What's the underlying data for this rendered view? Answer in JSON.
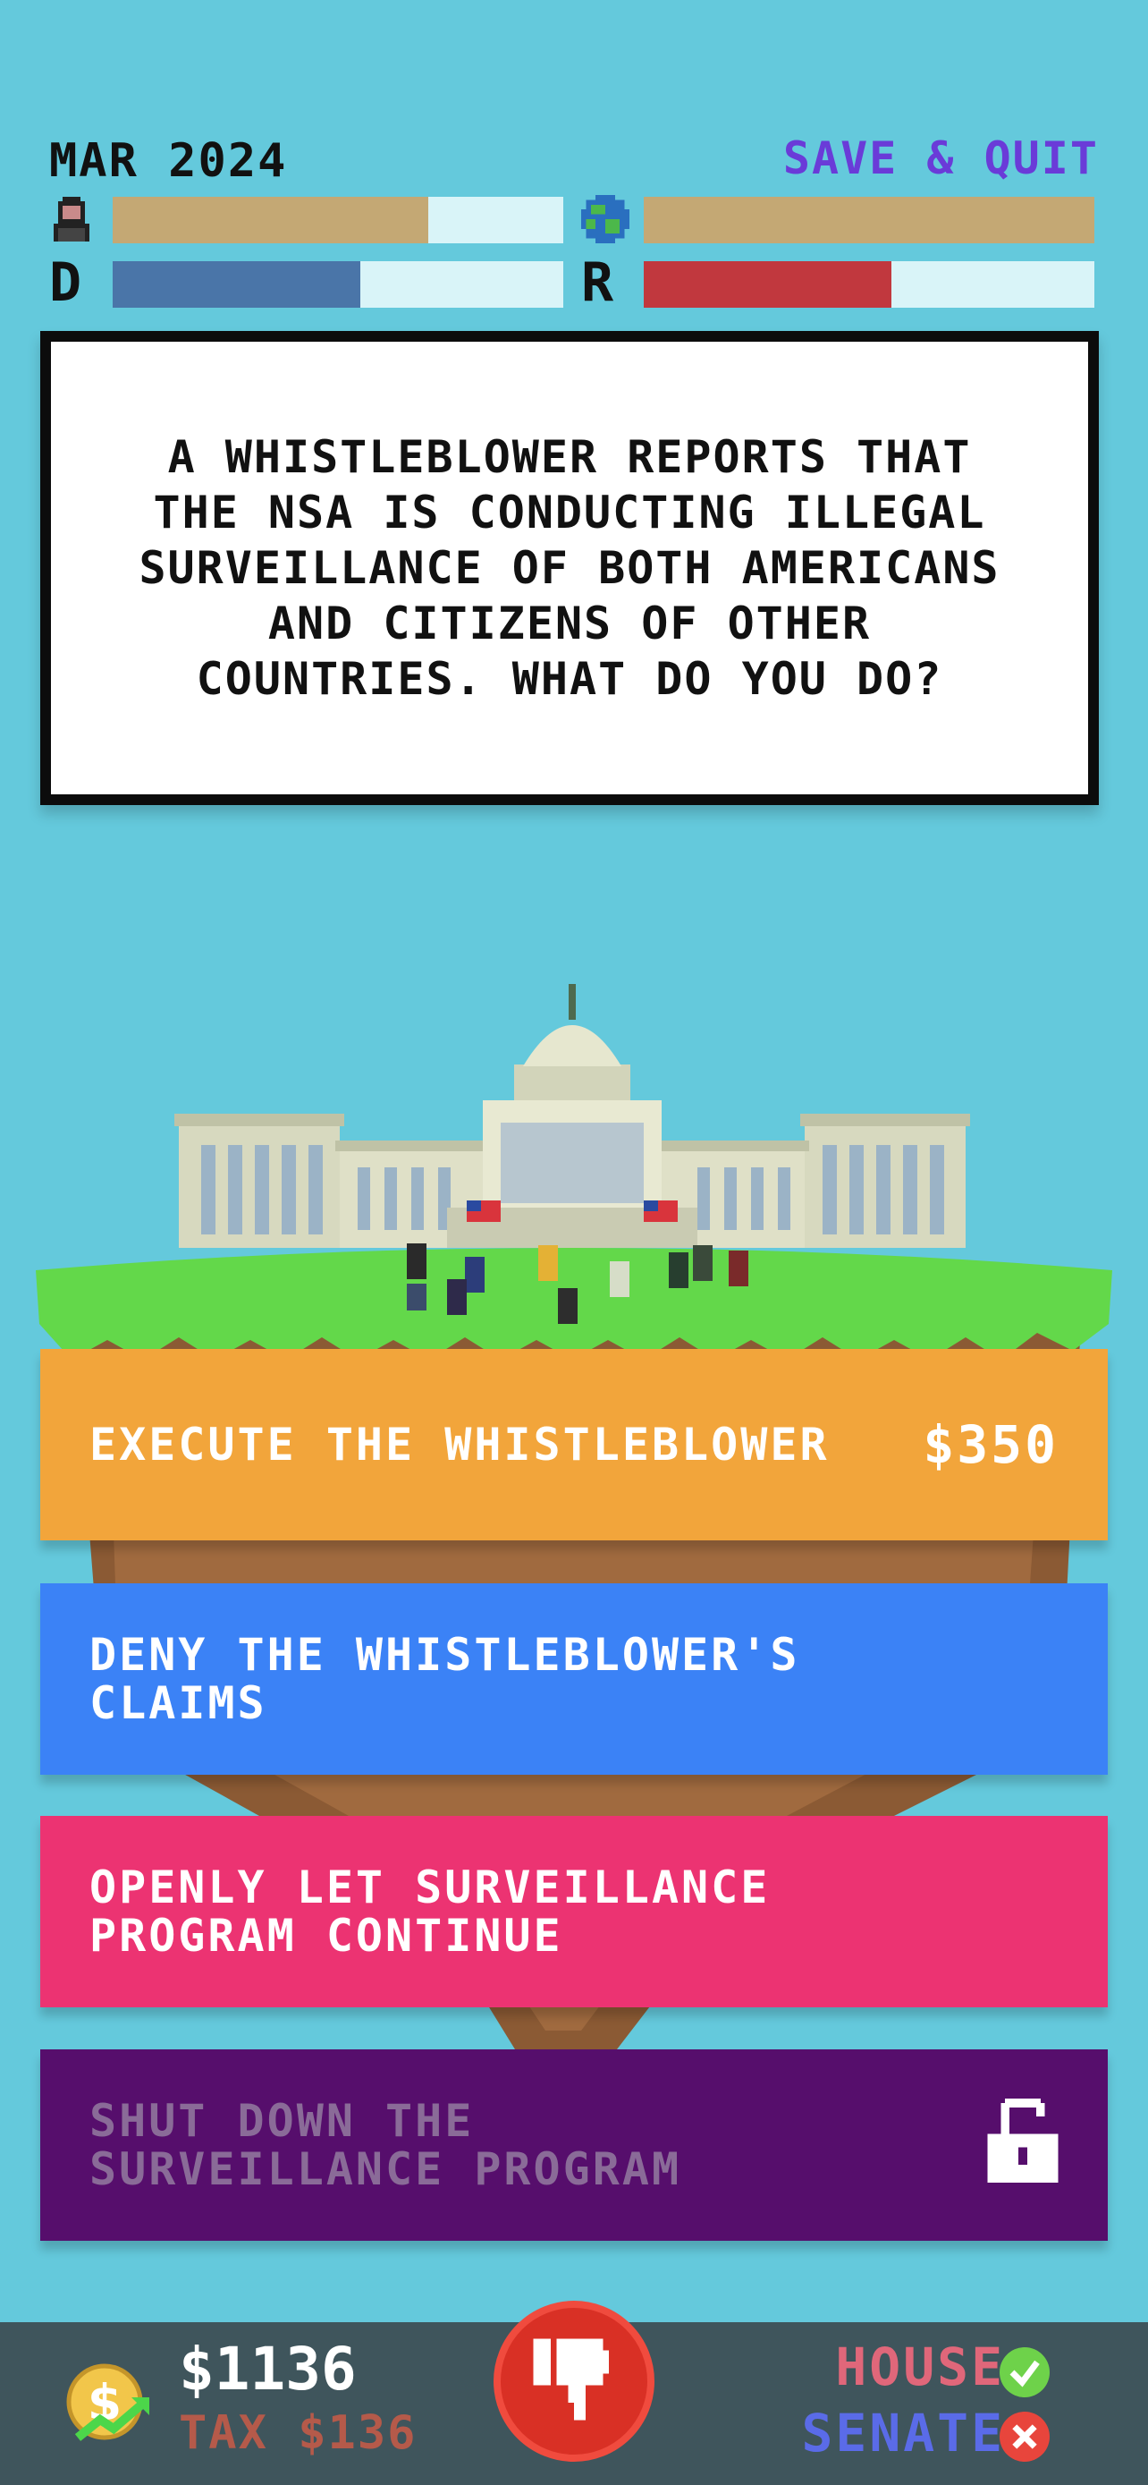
{
  "header": {
    "date": "MAR 2024",
    "save_quit": "SAVE & QUIT",
    "meters": {
      "approval": {
        "icon": "person-icon",
        "level": 0.7,
        "color": "#c4a874"
      },
      "world": {
        "icon": "globe-icon",
        "level": 1.0,
        "color": "#c4a874"
      },
      "democrat": {
        "label": "D",
        "level": 0.55,
        "color": "#4a75a8"
      },
      "republican": {
        "label": "R",
        "level": 0.55,
        "color": "#c1383e"
      }
    }
  },
  "question": "A whistleblower reports that the NSA is conducting illegal surveillance of both Americans and citizens of other countries. What do you do?",
  "choices": [
    {
      "label": "Execute the whistleblower",
      "cost": "$350",
      "color": "#f2a53b"
    },
    {
      "label": "Deny the whistleblower's claims",
      "color": "#3b82f6"
    },
    {
      "label": "Openly let surveillance program continue",
      "color": "#ec3372"
    },
    {
      "label": "Shut down the surveillance program",
      "locked": true,
      "icon": "lock-icon",
      "color": "#560e6c"
    }
  ],
  "footer": {
    "money": "$1136",
    "tax": "TAX $136",
    "veto_icon": "thumbs-down-icon",
    "house": {
      "label": "HOUSE",
      "status": "check-icon",
      "color": "#6ed24a"
    },
    "senate": {
      "label": "SENATE",
      "status": "x-icon",
      "color": "#e8453c"
    }
  }
}
